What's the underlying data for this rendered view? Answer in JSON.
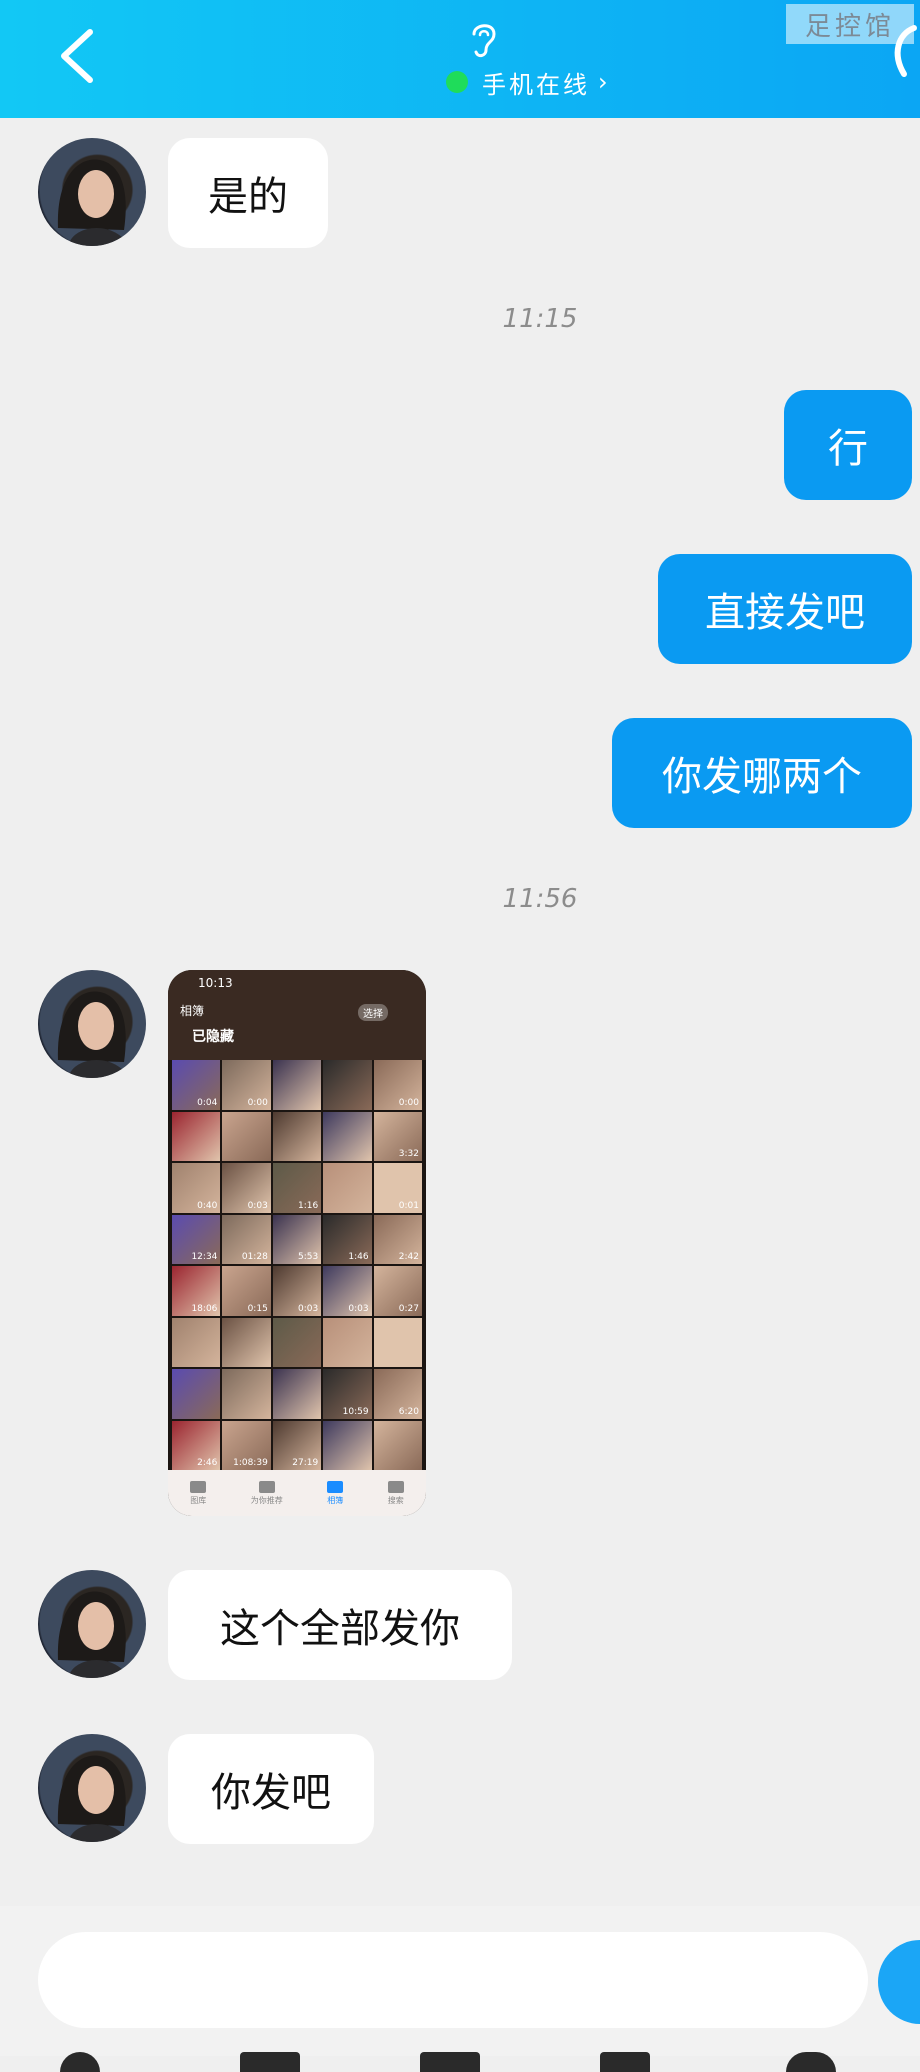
{
  "header": {
    "status_text": "手机在线",
    "watermark": "足控馆",
    "online_color": "#1fdc5a"
  },
  "messages": {
    "m1": "是的",
    "t1": "11:15",
    "m2": "行",
    "m3": "直接发吧",
    "m4": "你发哪两个",
    "t2": "11:56",
    "m6": "这个全部发你",
    "m7": "你发吧"
  },
  "screenshot": {
    "clock": "10:13",
    "back": "相簿",
    "album_title": "已隐藏",
    "select": "选择",
    "durations": [
      "0:04",
      "0:00",
      "",
      "",
      "0:00",
      "",
      "",
      "",
      "",
      "3:32",
      "0:40",
      "0:03",
      "1:16",
      "",
      "0:01",
      "12:34",
      "01:28",
      "5:53",
      "1:46",
      "2:42",
      "18:06",
      "0:15",
      "0:03",
      "0:03",
      "0:27",
      "",
      "",
      "",
      "",
      "",
      "",
      "",
      "",
      "10:59",
      "6:20",
      "2:46",
      "1:08:39",
      "27:19",
      "",
      ""
    ],
    "tabs": [
      "图库",
      "为你推荐",
      "相簿",
      "搜索"
    ]
  },
  "icons": {
    "back": "chevron-left-icon",
    "ear": "ear-icon",
    "phone": "phone-icon"
  }
}
